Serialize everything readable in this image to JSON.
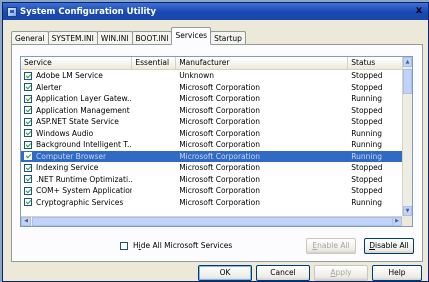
{
  "window": {
    "title": "System Configuration Utility",
    "close_glyph": "x"
  },
  "tabs": [
    {
      "label": "General",
      "active": false
    },
    {
      "label": "SYSTEM.INI",
      "active": false
    },
    {
      "label": "WIN.INI",
      "active": false
    },
    {
      "label": "BOOT.INI",
      "active": false
    },
    {
      "label": "Services",
      "active": true
    },
    {
      "label": "Startup",
      "active": false
    }
  ],
  "columns": [
    "Service",
    "Essential",
    "Manufacturer",
    "Status"
  ],
  "services": [
    {
      "name": "Adobe LM Service",
      "essential": "",
      "manufacturer": "Unknown",
      "status": "Stopped",
      "checked": true
    },
    {
      "name": "Alerter",
      "essential": "",
      "manufacturer": "Microsoft Corporation",
      "status": "Stopped",
      "checked": true
    },
    {
      "name": "Application Layer Gatew...",
      "essential": "",
      "manufacturer": "Microsoft Corporation",
      "status": "Running",
      "checked": true
    },
    {
      "name": "Application Management",
      "essential": "",
      "manufacturer": "Microsoft Corporation",
      "status": "Stopped",
      "checked": true
    },
    {
      "name": "ASP.NET State Service",
      "essential": "",
      "manufacturer": "Microsoft Corporation",
      "status": "Stopped",
      "checked": true
    },
    {
      "name": "Windows Audio",
      "essential": "",
      "manufacturer": "Microsoft Corporation",
      "status": "Running",
      "checked": true
    },
    {
      "name": "Background Intelligent T...",
      "essential": "",
      "manufacturer": "Microsoft Corporation",
      "status": "Running",
      "checked": true
    },
    {
      "name": "Computer Browser",
      "essential": "",
      "manufacturer": "Microsoft Corporation",
      "status": "Running",
      "checked": true,
      "selected": true
    },
    {
      "name": "Indexing Service",
      "essential": "",
      "manufacturer": "Microsoft Corporation",
      "status": "Stopped",
      "checked": true
    },
    {
      "name": ".NET Runtime Optimizati...",
      "essential": "",
      "manufacturer": "Microsoft Corporation",
      "status": "Stopped",
      "checked": true
    },
    {
      "name": "COM+ System Application",
      "essential": "",
      "manufacturer": "Microsoft Corporation",
      "status": "Stopped",
      "checked": true
    },
    {
      "name": "Cryptographic Services",
      "essential": "",
      "manufacturer": "Microsoft Corporation",
      "status": "Running",
      "checked": true
    }
  ],
  "hide_ms": {
    "label_prefix": "H",
    "label_accel": "i",
    "label_rest": "de All Microsoft Services",
    "checked": false
  },
  "buttons": {
    "enable_all": {
      "accel": "E",
      "rest": "nable All",
      "enabled": false
    },
    "disable_all": {
      "accel": "D",
      "rest": "isable All",
      "enabled": true
    },
    "ok": {
      "label": "OK"
    },
    "cancel": {
      "label": "Cancel"
    },
    "apply": {
      "accel": "A",
      "rest": "pply",
      "enabled": false
    },
    "help": {
      "label": "Help"
    }
  },
  "colors": {
    "title_bar": "#1849b3",
    "selection": "#316ac5",
    "face": "#ece9d8"
  }
}
